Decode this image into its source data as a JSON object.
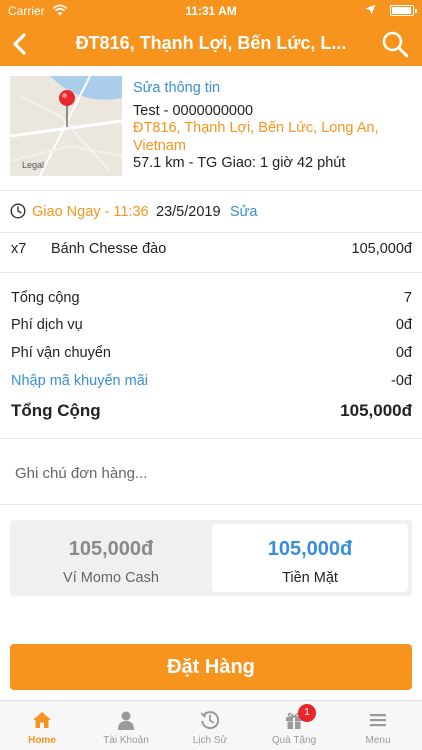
{
  "status_bar": {
    "carrier": "Carrier",
    "time": "11:31 AM",
    "battery_level": 0.95
  },
  "nav": {
    "title": "ĐT816, Thạnh Lợi, Bến Lức, L...",
    "back_icon": "chevron-left-icon",
    "search_icon": "search-icon"
  },
  "address": {
    "map_legal": "Legal",
    "edit_label": "Sửa thông tin",
    "contact": "Test - 0000000000",
    "address_line": "ĐT816, Thạnh Lợi, Bến Lức, Long An, Vietnam",
    "distance_time": "57.1 km - TG Giao: 1 giờ 42 phút"
  },
  "delivery": {
    "label": "Giao Ngay - 11:36",
    "date": "23/5/2019",
    "change_label": "Sửa"
  },
  "items": [
    {
      "qty": "x7",
      "name": "Bánh Chesse đào",
      "price": "105,000đ"
    }
  ],
  "summary": {
    "subtotal_label": "Tổng cộng",
    "subtotal_value": "7",
    "service_fee_label": "Phí dịch vụ",
    "service_fee_value": "0đ",
    "shipping_label": "Phí vận chuyển",
    "shipping_value": "0đ",
    "promo_label": "Nhập mã khuyến mãi",
    "promo_value": "-0đ",
    "total_label": "Tổng Cộng",
    "total_value": "105,000đ"
  },
  "note": {
    "placeholder": "Ghi chú đơn hàng...",
    "value": ""
  },
  "payment": {
    "momo_amount": "105,000đ",
    "momo_label": "Ví Momo Cash",
    "cash_amount": "105,000đ",
    "cash_label": "Tiền Mặt",
    "selected": "cash"
  },
  "order_button": "Đặt Hàng",
  "tabs": [
    {
      "label": "Home",
      "icon": "home-icon",
      "active": true
    },
    {
      "label": "Tài Khoản",
      "icon": "account-icon",
      "active": false
    },
    {
      "label": "Lịch Sử",
      "icon": "history-icon",
      "active": false
    },
    {
      "label": "Quà Tặng",
      "icon": "gift-icon",
      "active": false,
      "badge": "1"
    },
    {
      "label": "Menu",
      "icon": "menu-icon",
      "active": false
    }
  ],
  "colors": {
    "brand_orange": "#f7941d",
    "link_blue": "#3a8fd6",
    "badge_red": "#e8262b"
  }
}
